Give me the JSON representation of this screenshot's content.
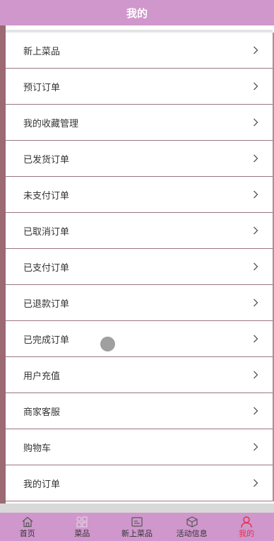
{
  "header": {
    "title": "我的"
  },
  "menu": {
    "items": [
      {
        "label": "新上菜品"
      },
      {
        "label": "预订订单"
      },
      {
        "label": "我的收藏管理"
      },
      {
        "label": "已发货订单"
      },
      {
        "label": "未支付订单"
      },
      {
        "label": "已取消订单"
      },
      {
        "label": "已支付订单"
      },
      {
        "label": "已退款订单"
      },
      {
        "label": "已完成订单"
      },
      {
        "label": "用户充值"
      },
      {
        "label": "商家客服"
      },
      {
        "label": "购物车"
      },
      {
        "label": "我的订单"
      }
    ],
    "chevron_icon": "chevron-right-icon"
  },
  "tabbar": {
    "tabs": [
      {
        "label": "首页",
        "icon": "home-icon",
        "active": false
      },
      {
        "label": "菜品",
        "icon": "grid-icon",
        "active": false
      },
      {
        "label": "新上菜品",
        "icon": "image-icon",
        "active": false
      },
      {
        "label": "活动信息",
        "icon": "box-icon",
        "active": false
      },
      {
        "label": "我的",
        "icon": "user-icon",
        "active": true
      }
    ]
  },
  "colors": {
    "header_bg": "#cf97cc",
    "active_tab": "#e8324b",
    "left_bar": "#9b6a74",
    "row_divider": "#9a7585"
  }
}
